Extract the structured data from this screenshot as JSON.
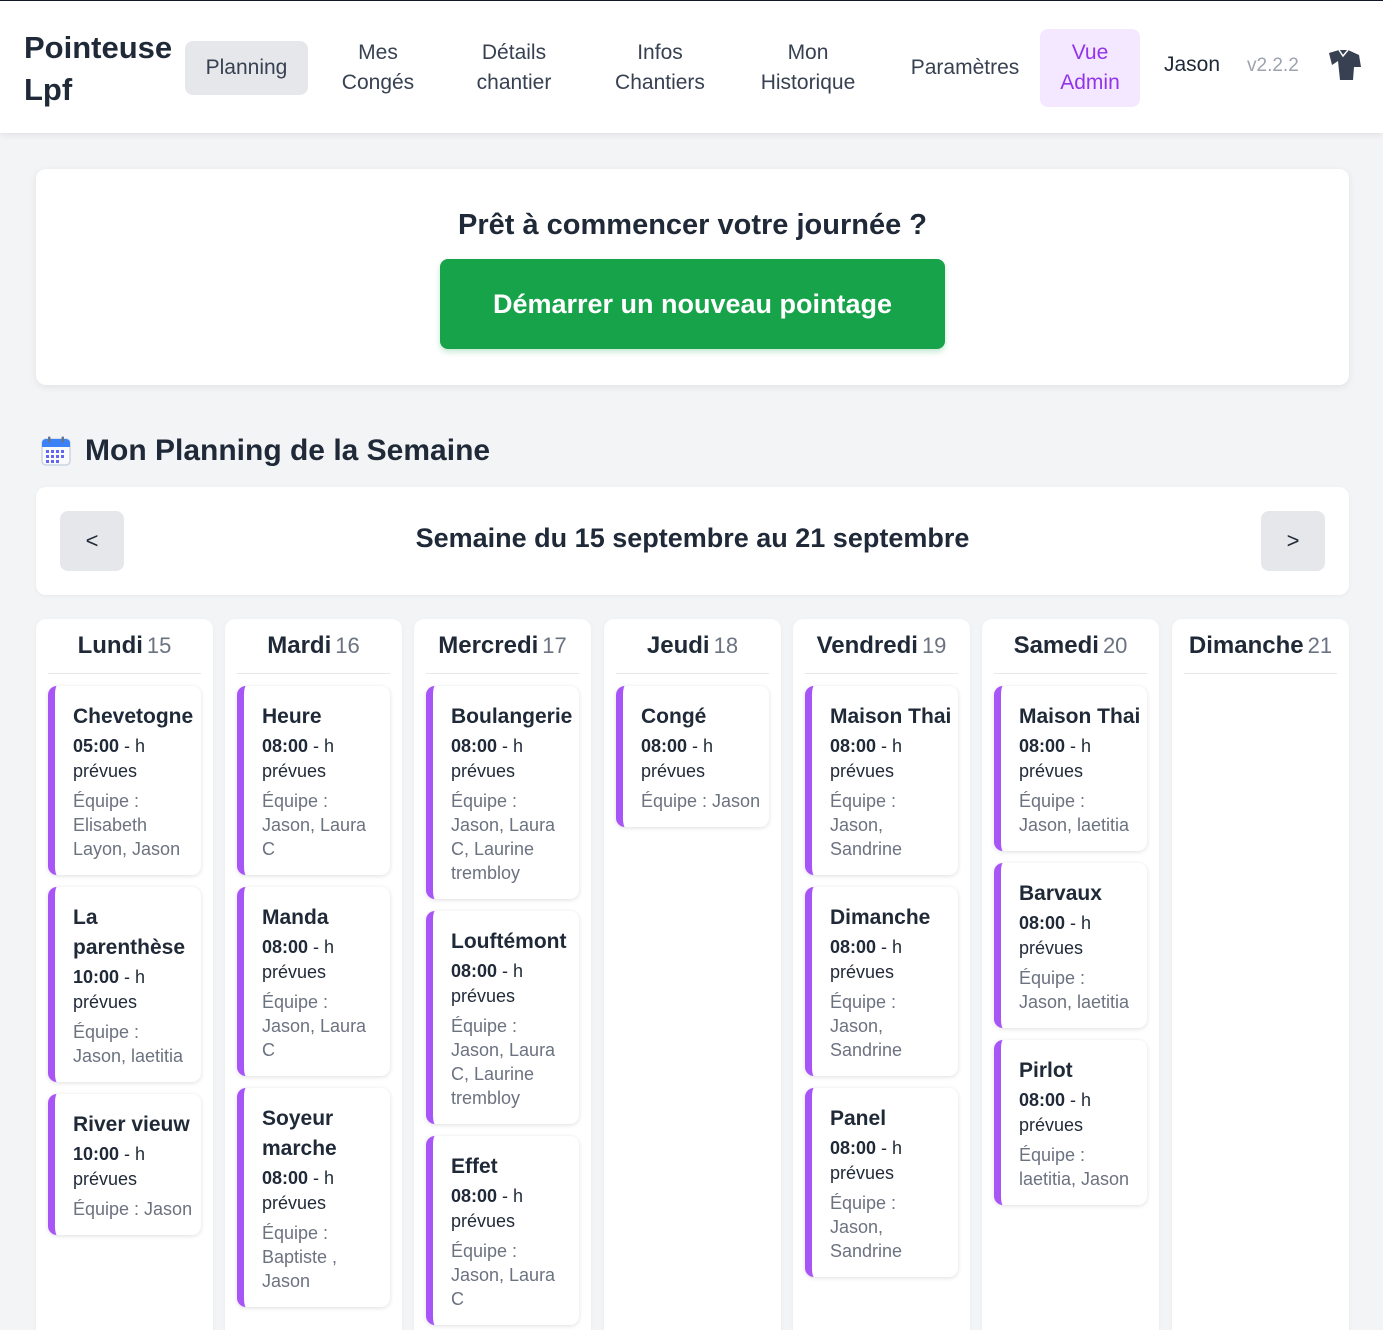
{
  "app": {
    "brand": "Pointeuse Lpf",
    "nav": [
      {
        "label": "Planning"
      },
      {
        "label": "Mes\nCongés"
      },
      {
        "label": "Détails\nchantier"
      },
      {
        "label": "Infos\nChantiers"
      },
      {
        "label": "Mon\nHistorique"
      },
      {
        "label": "Paramètres"
      },
      {
        "label": "Vue\nAdmin"
      }
    ],
    "user": "Jason",
    "version": "v2.2.2"
  },
  "colors": {
    "primary_green": "#16a34a",
    "accent_purple": "#a855f7",
    "admin_bg": "#f3e8ff",
    "admin_text": "#9333ea"
  },
  "start": {
    "title": "Prêt à commencer votre journée ?",
    "button": "Démarrer un nouveau pointage"
  },
  "planning": {
    "icon": "calendar-icon",
    "title": "Mon Planning de la Semaine",
    "week_label": "Semaine du 15 septembre au 21 septembre",
    "prev_label": "<",
    "next_label": ">",
    "days": [
      {
        "name": "Lundi",
        "num": "15",
        "tasks": [
          {
            "name": "Chevetogne",
            "time": "05:00",
            "suffix": " - h prévues",
            "team": "Équipe : Elisabeth Layon, Jason"
          },
          {
            "name": "La parenthèse",
            "time": "10:00",
            "suffix": " - h prévues",
            "team": "Équipe : Jason, laetitia"
          },
          {
            "name": "River vieuw",
            "time": "10:00",
            "suffix": " - h prévues",
            "team": "Équipe : Jason"
          }
        ]
      },
      {
        "name": "Mardi",
        "num": "16",
        "tasks": [
          {
            "name": "Heure",
            "time": "08:00",
            "suffix": " - h prévues",
            "team": "Équipe : Jason, Laura C"
          },
          {
            "name": "Manda",
            "time": "08:00",
            "suffix": " - h prévues",
            "team": "Équipe : Jason, Laura C"
          },
          {
            "name": "Soyeur marche",
            "time": "08:00",
            "suffix": " - h prévues",
            "team": "Équipe : Baptiste , Jason"
          }
        ]
      },
      {
        "name": "Mercredi",
        "num": "17",
        "tasks": [
          {
            "name": "Boulangerie",
            "time": "08:00",
            "suffix": " - h prévues",
            "team": "Équipe : Jason, Laura C, Laurine trembloy"
          },
          {
            "name": "Louftémont",
            "time": "08:00",
            "suffix": " - h prévues",
            "team": "Équipe : Jason, Laura C, Laurine trembloy"
          },
          {
            "name": "Effet",
            "time": "08:00",
            "suffix": " - h prévues",
            "team": "Équipe : Jason, Laura C"
          }
        ]
      },
      {
        "name": "Jeudi",
        "num": "18",
        "tasks": [
          {
            "name": "Congé",
            "time": "08:00",
            "suffix": " - h prévues",
            "team": "Équipe : Jason"
          }
        ]
      },
      {
        "name": "Vendredi",
        "num": "19",
        "tasks": [
          {
            "name": "Maison Thai",
            "time": "08:00",
            "suffix": " - h prévues",
            "team": "Équipe : Jason, Sandrine"
          },
          {
            "name": "Dimanche",
            "time": "08:00",
            "suffix": " - h prévues",
            "team": "Équipe : Jason, Sandrine"
          },
          {
            "name": "Panel",
            "time": "08:00",
            "suffix": " - h prévues",
            "team": "Équipe : Jason, Sandrine"
          }
        ]
      },
      {
        "name": "Samedi",
        "num": "20",
        "tasks": [
          {
            "name": "Maison Thai",
            "time": "08:00",
            "suffix": " - h prévues",
            "team": "Équipe : Jason, laetitia"
          },
          {
            "name": "Barvaux",
            "time": "08:00",
            "suffix": " - h prévues",
            "team": "Équipe : Jason, laetitia"
          },
          {
            "name": "Pirlot",
            "time": "08:00",
            "suffix": " - h prévues",
            "team": "Équipe : laetitia, Jason"
          }
        ]
      },
      {
        "name": "Dimanche",
        "num": "21",
        "tasks": []
      }
    ]
  }
}
